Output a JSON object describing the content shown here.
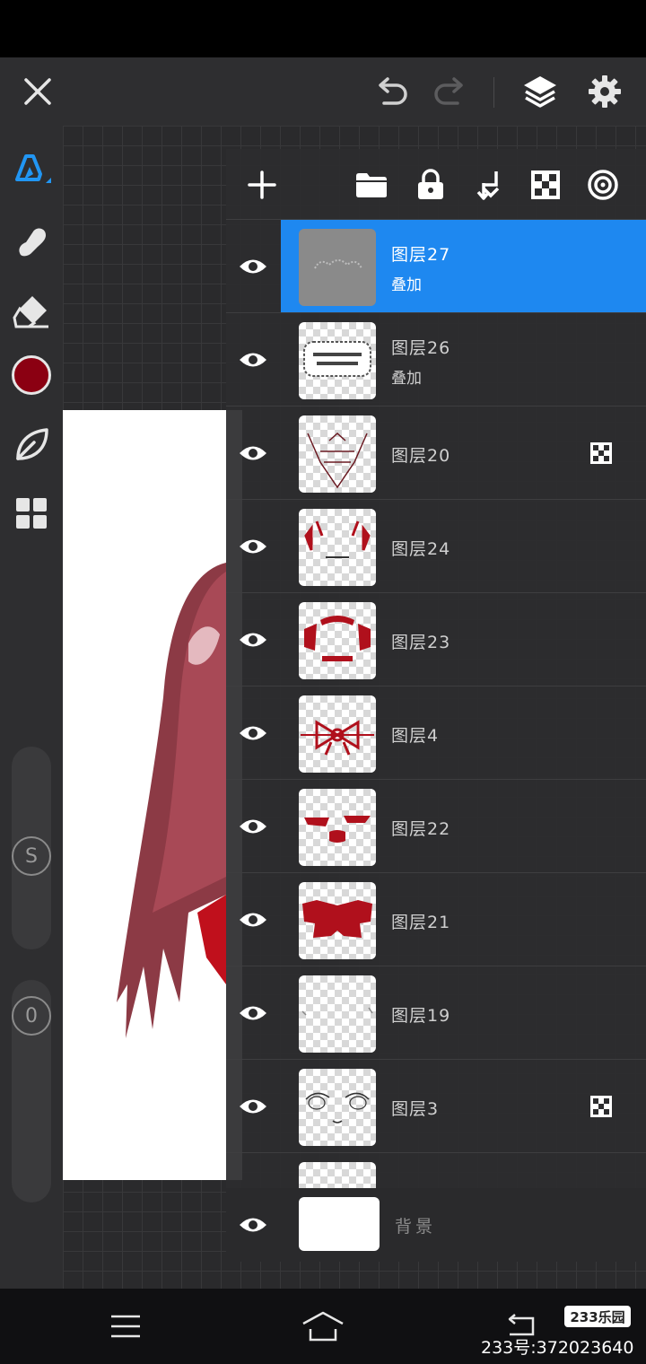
{
  "colors": {
    "accent": "#1e88f0",
    "current_brush_color": "#8b0012",
    "toolbar_bg": "#2e2e30",
    "panel_bg": "#2c2c2e"
  },
  "top_bar": {
    "icons": [
      "close-icon",
      "undo-icon",
      "redo-icon",
      "layers-icon",
      "gear-icon"
    ]
  },
  "left_toolbar": {
    "tools": [
      "pencil-icon",
      "smudge-icon",
      "eraser-icon",
      "color-swatch",
      "leaf-icon",
      "grid-icon"
    ],
    "size_button": "S",
    "opacity_button": "0"
  },
  "layers_panel": {
    "toolbar_icons": [
      "add-icon",
      "folder-icon",
      "lock-icon",
      "merge-down-icon",
      "checker-icon",
      "target-icon"
    ],
    "layers": [
      {
        "name": "图层27",
        "blend": "叠加",
        "selected": true,
        "alpha_lock": false
      },
      {
        "name": "图层26",
        "blend": "叠加",
        "selected": false,
        "alpha_lock": false
      },
      {
        "name": "图层20",
        "blend": "",
        "selected": false,
        "alpha_lock": true
      },
      {
        "name": "图层24",
        "blend": "",
        "selected": false,
        "alpha_lock": false
      },
      {
        "name": "图层23",
        "blend": "",
        "selected": false,
        "alpha_lock": false
      },
      {
        "name": "图层4",
        "blend": "",
        "selected": false,
        "alpha_lock": false
      },
      {
        "name": "图层22",
        "blend": "",
        "selected": false,
        "alpha_lock": false
      },
      {
        "name": "图层21",
        "blend": "",
        "selected": false,
        "alpha_lock": false
      },
      {
        "name": "图层19",
        "blend": "",
        "selected": false,
        "alpha_lock": false
      },
      {
        "name": "图层3",
        "blend": "",
        "selected": false,
        "alpha_lock": true
      }
    ],
    "background_layer": {
      "name": "背景"
    }
  },
  "nav_bar": {
    "icons": [
      "menu-icon",
      "home-icon",
      "back-icon"
    ]
  },
  "watermark": {
    "logo": "233乐园",
    "id_text": "233号:372023640"
  }
}
